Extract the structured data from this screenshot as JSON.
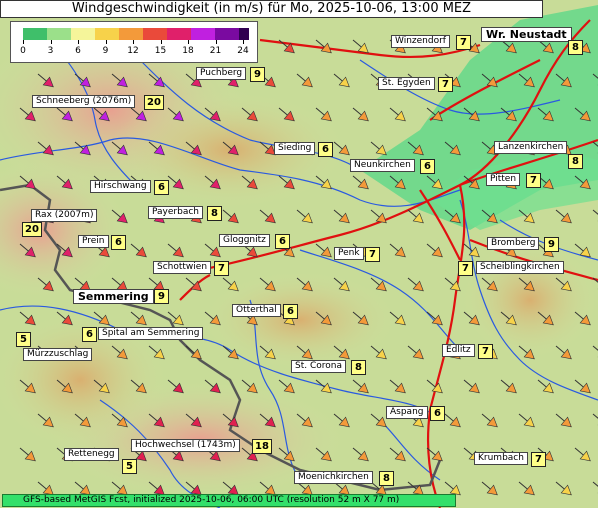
{
  "title": "Windgeschwindigkeit (in m/s) für Mo, 2025-10-06, 13:00 MEZ",
  "legend": {
    "ticks": [
      "0",
      "3",
      "6",
      "9",
      "12",
      "15",
      "18",
      "21",
      "24"
    ],
    "colors": [
      "#3fbf6a",
      "#9be08a",
      "#f5f59a",
      "#f7d24a",
      "#f39a3a",
      "#ea4a3a",
      "#e0206a",
      "#c020e0",
      "#7a0aa0",
      "#300050"
    ]
  },
  "places": [
    {
      "name": "Winzendorf",
      "speed": "7"
    },
    {
      "name": "Wr. Neustadt",
      "speed": "8"
    },
    {
      "name": "Puchberg",
      "speed": "9"
    },
    {
      "name": "St. Egyden",
      "speed": "7"
    },
    {
      "name": "Schneeberg (2076m)",
      "speed": "20"
    },
    {
      "name": "Sieding",
      "speed": "6"
    },
    {
      "name": "Neunkirchen",
      "speed": "6"
    },
    {
      "name": "Lanzenkirchen",
      "speed": "8"
    },
    {
      "name": "Pitten",
      "speed": "7"
    },
    {
      "name": "Hirschwang",
      "speed": "6"
    },
    {
      "name": "Payerbach",
      "speed": "8"
    },
    {
      "name": "Rax (2007m)",
      "speed": "20"
    },
    {
      "name": "Prein",
      "speed": "6"
    },
    {
      "name": "Gloggnitz",
      "speed": "6"
    },
    {
      "name": "Bromberg",
      "speed": "9"
    },
    {
      "name": "Penk",
      "speed": "7"
    },
    {
      "name": "Schottwien",
      "speed": "7"
    },
    {
      "name": "Scheiblingkirchen",
      "speed": "7"
    },
    {
      "name": "Semmering",
      "speed": "9"
    },
    {
      "name": "Otterthal",
      "speed": "6"
    },
    {
      "name": "Spital am Semmering",
      "speed": "6"
    },
    {
      "name": "Mürzzuschlag",
      "speed": "5"
    },
    {
      "name": "Edlitz",
      "speed": "7"
    },
    {
      "name": "St. Corona",
      "speed": "8"
    },
    {
      "name": "Aspang",
      "speed": "6"
    },
    {
      "name": "Hochwechsel (1743m)",
      "speed": "18"
    },
    {
      "name": "Rettenegg",
      "speed": "5"
    },
    {
      "name": "Krumbach",
      "speed": "7"
    },
    {
      "name": "Moenichkirchen",
      "speed": "8"
    }
  ],
  "footer": "GFS-based MetGIS Fcst, initialized 2025-10-06, 06:00 UTC  (resolution 52 m X 77 m)"
}
